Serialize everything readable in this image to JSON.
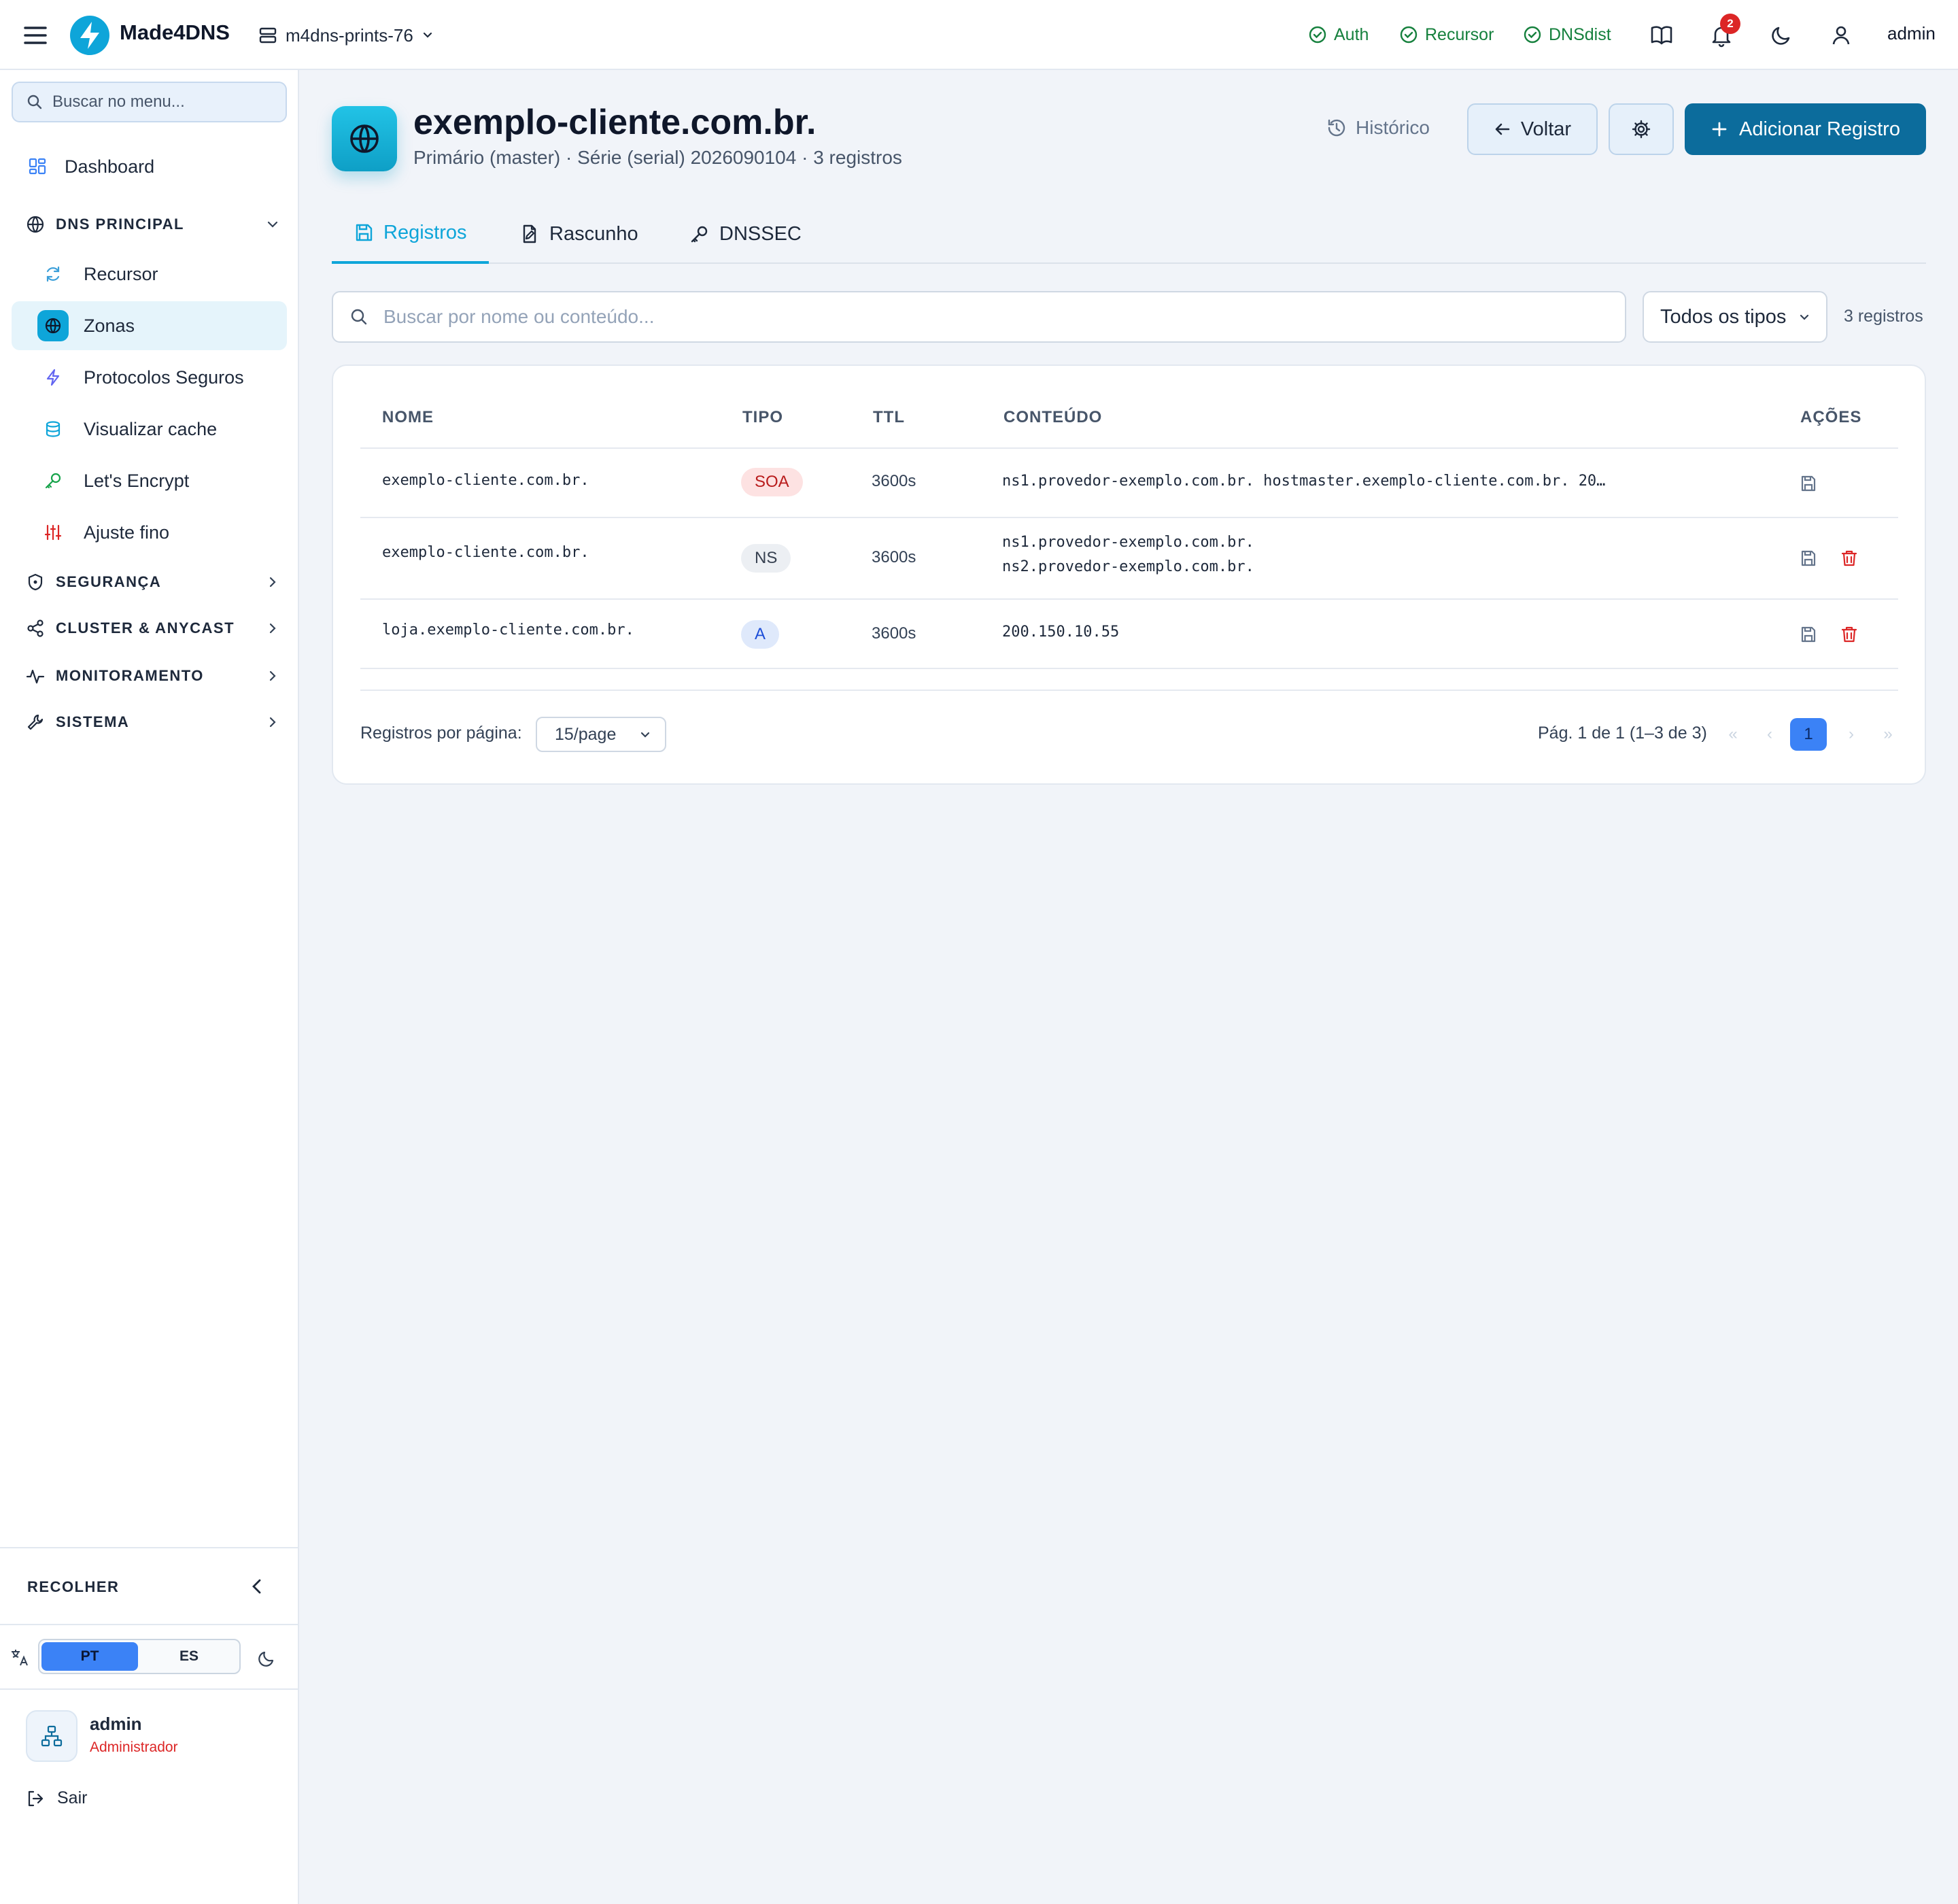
{
  "topbar": {
    "brand": "Made4DNS",
    "server": "m4dns-prints-76",
    "status": [
      {
        "label": "Auth"
      },
      {
        "label": "Recursor"
      },
      {
        "label": "DNSdist"
      }
    ],
    "notifications_count": "2",
    "user": "admin",
    "status_color": "#15803d"
  },
  "sidebar": {
    "search_placeholder": "Buscar no menu...",
    "dashboard": "Dashboard",
    "section_dns": "DNS PRINCIPAL",
    "dns_items": [
      {
        "label": "Recursor",
        "icon": "refresh-icon"
      },
      {
        "label": "Zonas",
        "icon": "globe-icon"
      },
      {
        "label": "Protocolos Seguros",
        "icon": "bolt-icon"
      },
      {
        "label": "Visualizar cache",
        "icon": "database-icon"
      },
      {
        "label": "Let's Encrypt",
        "icon": "key-icon"
      },
      {
        "label": "Ajuste fino",
        "icon": "sliders-icon"
      }
    ],
    "sections": [
      {
        "label": "SEGURANÇA"
      },
      {
        "label": "CLUSTER & ANYCAST"
      },
      {
        "label": "MONITORAMENTO"
      },
      {
        "label": "SISTEMA"
      }
    ],
    "collapse": "RECOLHER",
    "languages": [
      "PT",
      "ES"
    ],
    "active_language": "PT",
    "user_name": "admin",
    "user_role": "Administrador",
    "logout": "Sair"
  },
  "zone": {
    "name": "exemplo-cliente.com.br.",
    "subtitle": "Primário (master) · Série (serial) 2026090104 · 3 registros",
    "history": "Histórico",
    "back": "Voltar",
    "add": "Adicionar Registro",
    "accent": "#0c6c9c"
  },
  "tabs": [
    {
      "label": "Registros",
      "active": true
    },
    {
      "label": "Rascunho",
      "active": false
    },
    {
      "label": "DNSSEC",
      "active": false
    }
  ],
  "filters": {
    "search_placeholder": "Buscar por nome ou conteúdo...",
    "type_select": "Todos os tipos",
    "count": "3 registros"
  },
  "table": {
    "columns": [
      "NOME",
      "TIPO",
      "TTL",
      "CONTEÚDO",
      "AÇÕES"
    ],
    "rows": [
      {
        "name": "exemplo-cliente.com.br.",
        "type": "SOA",
        "ttl": "3600s",
        "content": [
          "ns1.provedor-exemplo.com.br. hostmaster.exemplo-cliente.com.br. 20…"
        ],
        "deletable": false
      },
      {
        "name": "exemplo-cliente.com.br.",
        "type": "NS",
        "ttl": "3600s",
        "content": [
          "ns1.provedor-exemplo.com.br.",
          "ns2.provedor-exemplo.com.br."
        ],
        "deletable": true
      },
      {
        "name": "loja.exemplo-cliente.com.br.",
        "type": "A",
        "ttl": "3600s",
        "content": [
          "200.150.10.55"
        ],
        "deletable": true
      }
    ]
  },
  "pagination": {
    "per_page_label": "Registros por página:",
    "per_page": "15/page",
    "info": "Pág. 1 de 1 (1–3 de 3)",
    "first": "«",
    "prev": "‹",
    "current": "1",
    "next": "›",
    "last": "»"
  }
}
